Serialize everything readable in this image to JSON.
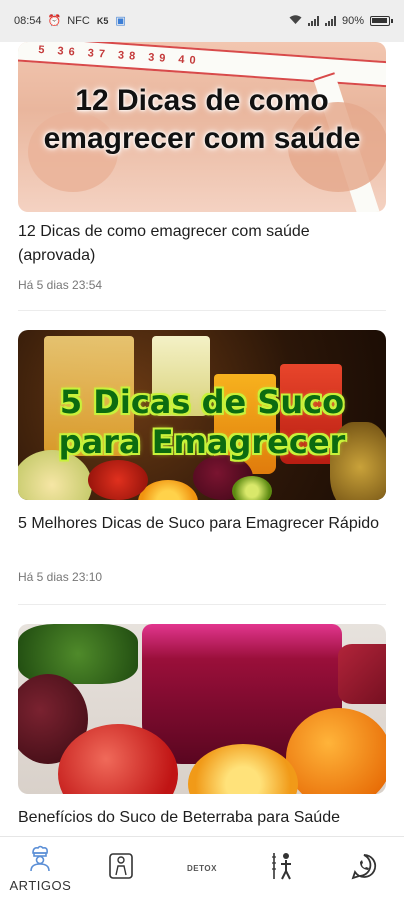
{
  "status_bar": {
    "time": "08:54",
    "left_icons": [
      "alarm-icon",
      "nfc-icon",
      "data-speed-icon",
      "app-notification-icon"
    ],
    "nfc_label": "NFC",
    "speed_label": "K5",
    "battery": "90%"
  },
  "articles": [
    {
      "image_caption": "12 Dicas de como emagrecer com saúde",
      "title": "12 Dicas de como emagrecer com saúde (aprovada)",
      "date": "Há 5 dias 23:54"
    },
    {
      "image_caption": "5 Dicas de Suco para Emagrecer",
      "title": "5 Melhores Dicas de Suco para Emagrecer Rápido",
      "date": "Há 5 dias 23:10"
    },
    {
      "image_caption": "",
      "title": "Benefícios do Suco de Beterraba para Saúde",
      "date": ""
    }
  ],
  "tape_numbers": "5 36 37 38 39 40",
  "bottom_nav": {
    "items": [
      {
        "label": "ARTIGOS",
        "icon": "chef-icon",
        "active": true
      },
      {
        "label": "",
        "icon": "scale-icon"
      },
      {
        "label": "DETOX",
        "icon": "detox-icon"
      },
      {
        "label": "",
        "icon": "body-measure-icon"
      },
      {
        "label": "",
        "icon": "whatsapp-icon"
      }
    ]
  },
  "colors": {
    "active_nav_icon": "#5b8fd6",
    "caption_green": "#0c6b10",
    "caption_glow": "#c8f23a"
  }
}
